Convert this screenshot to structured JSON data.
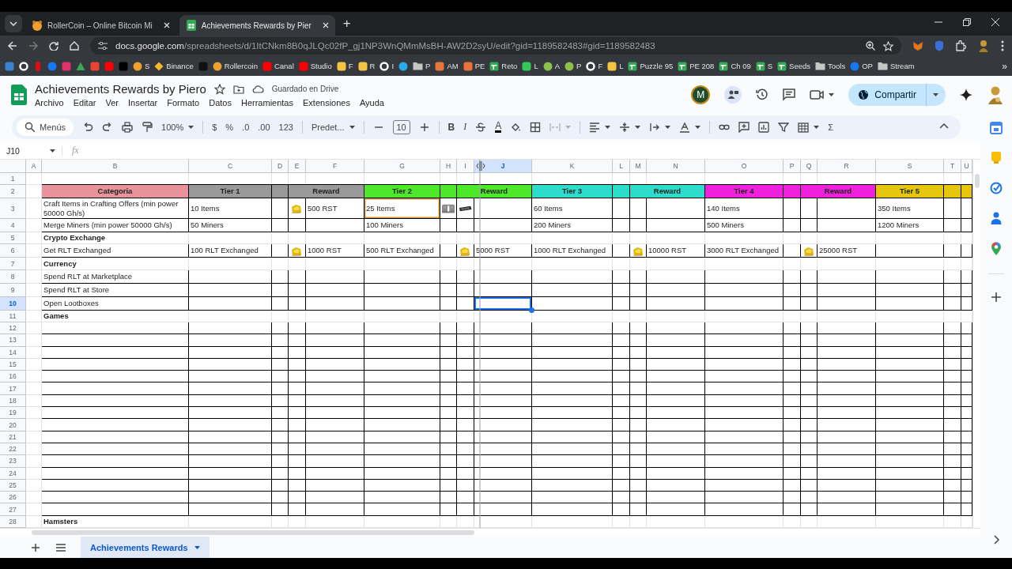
{
  "browser": {
    "tabs": [
      {
        "kind": "site",
        "title": "RollerCoin – Online Bitcoin Mi",
        "selected": false
      },
      {
        "kind": "sheets",
        "title": "Achievements Rewards by Pier",
        "selected": true
      }
    ],
    "new_tab": "+",
    "url": {
      "host": "docs.google.com",
      "path": "/spreadsheets/d/1ItCNkm8B0qJLQc02fP_gj1NP3WnQMmMsBH-AW2D2syU/edit?gid=1189582483#gid=1189582483"
    },
    "bookmarks": [
      {
        "kind": "square",
        "color": "#3b82d6"
      },
      {
        "kind": "ring",
        "color": "#ffffff"
      },
      {
        "kind": "bar",
        "color": "#e50914"
      },
      {
        "kind": "circle",
        "color": "#1877f2"
      },
      {
        "kind": "square",
        "color": "#e1306c"
      },
      {
        "kind": "triangle",
        "color": "#34a853"
      },
      {
        "kind": "square",
        "color": "#ea4335"
      },
      {
        "kind": "square",
        "color": "#ff0000"
      },
      {
        "kind": "square",
        "color": "#000000"
      },
      {
        "kind": "circle",
        "color": "#f0a030",
        "label": "S"
      },
      {
        "kind": "diamond",
        "color": "#f3ba2f",
        "label": "Binance"
      },
      {
        "kind": "square",
        "color": "#111111"
      },
      {
        "kind": "circle",
        "color": "#f0a030",
        "label": "Rollercoin"
      },
      {
        "kind": "square",
        "color": "#ff0000",
        "label": "Canal"
      },
      {
        "kind": "square",
        "color": "#ff0000",
        "label": "Studio"
      },
      {
        "kind": "square",
        "color": "#f5c542",
        "label": "F"
      },
      {
        "kind": "square",
        "color": "#f5c542",
        "label": "R"
      },
      {
        "kind": "ring",
        "color": "#ffffff",
        "label": "I"
      },
      {
        "kind": "circle",
        "color": "#2aabee"
      },
      {
        "kind": "folder",
        "color": "#c4c7c5",
        "label": "P"
      },
      {
        "kind": "square",
        "color": "#e8743b",
        "label": "AM"
      },
      {
        "kind": "square",
        "color": "#e8743b",
        "label": "PE"
      },
      {
        "kind": "sheet",
        "color": "#34a853",
        "label": "Reto"
      },
      {
        "kind": "square",
        "color": "#34c759",
        "label": "L"
      },
      {
        "kind": "circle",
        "color": "#8bc34a",
        "label": "A"
      },
      {
        "kind": "circle",
        "color": "#8bc34a",
        "label": "P"
      },
      {
        "kind": "ring",
        "color": "#ffffff",
        "label": "F"
      },
      {
        "kind": "square",
        "color": "#f5c542",
        "label": "L"
      },
      {
        "kind": "sheet",
        "color": "#34a853",
        "label": "Puzzle 95"
      },
      {
        "kind": "sheet",
        "color": "#34a853",
        "label": "PE 208"
      },
      {
        "kind": "sheet",
        "color": "#34a853",
        "label": "Ch 09"
      },
      {
        "kind": "sheet",
        "color": "#34a853",
        "label": "S"
      },
      {
        "kind": "sheet",
        "color": "#34a853",
        "label": "Seeds"
      },
      {
        "kind": "folder",
        "color": "#c4c7c5",
        "label": "Tools"
      },
      {
        "kind": "circle",
        "color": "#1877f2",
        "label": "OP"
      },
      {
        "kind": "folder",
        "color": "#c4c7c5",
        "label": "Stream"
      }
    ],
    "more_bookmarks": "»"
  },
  "doc": {
    "title": "Achievements Rewards by Piero",
    "save_status": "Guardado en Drive",
    "menu": [
      "Archivo",
      "Editar",
      "Ver",
      "Insertar",
      "Formato",
      "Datos",
      "Herramientas",
      "Extensiones",
      "Ayuda"
    ],
    "avatar": "M",
    "share": "Compartir"
  },
  "toolbar": {
    "search_placeholder": "Menús",
    "zoom": "100%",
    "currency": "$",
    "percent": "%",
    "decrease_decimals": ".0",
    "increase_decimals": ".00",
    "number_format": "123",
    "font": "Predet...",
    "font_size": "10",
    "bold": "B",
    "italic": "I",
    "text_color": "A",
    "sum": "Σ"
  },
  "formula_bar": {
    "cell": "J10",
    "fx": "fx"
  },
  "sheet": {
    "columns": [
      {
        "label": "A",
        "selected": false
      },
      {
        "label": "B",
        "selected": false
      },
      {
        "label": "C",
        "selected": false
      },
      {
        "label": "D",
        "selected": false
      },
      {
        "label": "E",
        "selected": false
      },
      {
        "label": "F",
        "selected": false
      },
      {
        "label": "G",
        "selected": false
      },
      {
        "label": "H",
        "selected": false
      },
      {
        "label": "I",
        "selected": false
      },
      {
        "label": "J",
        "selected": true
      },
      {
        "label": "K",
        "selected": false
      },
      {
        "label": "L",
        "selected": false
      },
      {
        "label": "M",
        "selected": false
      },
      {
        "label": "N",
        "selected": false
      },
      {
        "label": "O",
        "selected": false
      },
      {
        "label": "P",
        "selected": false
      },
      {
        "label": "Q",
        "selected": false
      },
      {
        "label": "R",
        "selected": false
      },
      {
        "label": "S",
        "selected": false
      },
      {
        "label": "T",
        "selected": false
      },
      {
        "label": "U",
        "selected": false
      }
    ],
    "rows": [
      {
        "label": "1",
        "selected": false,
        "kind": "blank"
      },
      {
        "label": "2",
        "selected": false,
        "kind": "header",
        "cells": [
          {
            "kind": "empty"
          },
          {
            "kind": "text",
            "text": "Categoria",
            "color": "#e8939c"
          },
          {
            "kind": "text",
            "text": "Tier 1",
            "color": "#999999"
          },
          {
            "kind": "fill",
            "color": "#999999"
          },
          {
            "kind": "text",
            "text": "Reward",
            "color": "#999999"
          },
          {
            "kind": "merged"
          },
          {
            "kind": "text",
            "text": "Tier 2",
            "color": "#4de82a"
          },
          {
            "kind": "fill",
            "color": "#4de82a"
          },
          {
            "kind": "text",
            "text": "Reward",
            "color": "#4de82a"
          },
          {
            "kind": "merged"
          },
          {
            "kind": "text",
            "text": "Tier 3",
            "color": "#2ddccb"
          },
          {
            "kind": "fill",
            "color": "#2ddccb"
          },
          {
            "kind": "text",
            "text": "Reward",
            "color": "#2ddccb"
          },
          {
            "kind": "merged"
          },
          {
            "kind": "text",
            "text": "Tier 4",
            "color": "#ee22dc"
          },
          {
            "kind": "fill",
            "color": "#ee22dc"
          },
          {
            "kind": "text",
            "text": "Reward",
            "color": "#ee22dc"
          },
          {
            "kind": "merged"
          },
          {
            "kind": "text",
            "text": "Tier 5",
            "color": "#e5c60c"
          },
          {
            "kind": "fill",
            "color": "#e5c60c"
          },
          {
            "kind": "fill",
            "color": "#e5c60c"
          }
        ]
      },
      {
        "label": "3",
        "selected": false,
        "kind": "data",
        "cells": [
          {
            "kind": "empty"
          },
          {
            "kind": "text",
            "text": "Craft Items in Crafting Offers (min power 50000 Gh/s)"
          },
          {
            "kind": "text",
            "text": "10 Items"
          },
          {
            "kind": "empty"
          },
          {
            "kind": "coin"
          },
          {
            "kind": "text",
            "text": "500 RST"
          },
          {
            "kind": "outlined",
            "text": "25 Items"
          },
          {
            "kind": "picture"
          },
          {
            "kind": "picture"
          },
          {
            "kind": "empty"
          },
          {
            "kind": "text",
            "text": "60 Items"
          },
          {
            "kind": "empty"
          },
          {
            "kind": "empty"
          },
          {
            "kind": "empty"
          },
          {
            "kind": "text",
            "text": "140 Items"
          },
          {
            "kind": "empty"
          },
          {
            "kind": "empty"
          },
          {
            "kind": "empty"
          },
          {
            "kind": "text",
            "text": "350 Items"
          }
        ]
      },
      {
        "label": "4",
        "selected": false,
        "kind": "data",
        "cells": [
          {
            "kind": "empty"
          },
          {
            "kind": "text",
            "text": "Merge Miners (min power 50000 Gh/s)"
          },
          {
            "kind": "text",
            "text": "50 Miners"
          },
          {
            "kind": "empty"
          },
          {
            "kind": "empty"
          },
          {
            "kind": "empty"
          },
          {
            "kind": "text",
            "text": "100 Miners"
          },
          {
            "kind": "empty"
          },
          {
            "kind": "empty"
          },
          {
            "kind": "empty"
          },
          {
            "kind": "text",
            "text": "200 Miners"
          },
          {
            "kind": "empty"
          },
          {
            "kind": "empty"
          },
          {
            "kind": "empty"
          },
          {
            "kind": "text",
            "text": "500 Miners"
          },
          {
            "kind": "empty"
          },
          {
            "kind": "empty"
          },
          {
            "kind": "empty"
          },
          {
            "kind": "text",
            "text": "1200 Miners"
          }
        ]
      },
      {
        "label": "5",
        "selected": false,
        "kind": "section",
        "cells": [
          {
            "kind": "empty"
          },
          {
            "kind": "text",
            "text": "Crypto Exchange"
          }
        ]
      },
      {
        "label": "6",
        "selected": false,
        "kind": "data",
        "cells": [
          {
            "kind": "empty"
          },
          {
            "kind": "text",
            "text": "Get RLT Exchanged"
          },
          {
            "kind": "text",
            "text": "100 RLT Exchanged"
          },
          {
            "kind": "empty"
          },
          {
            "kind": "coin"
          },
          {
            "kind": "text",
            "text": "1000 RST"
          },
          {
            "kind": "text",
            "text": "500 RLT Exchanged"
          },
          {
            "kind": "empty"
          },
          {
            "kind": "coin"
          },
          {
            "kind": "text",
            "text": "5000 RST"
          },
          {
            "kind": "text",
            "text": "1000 RLT Exchanged"
          },
          {
            "kind": "empty"
          },
          {
            "kind": "coin"
          },
          {
            "kind": "text",
            "text": "10000 RST"
          },
          {
            "kind": "text",
            "text": "3000 RLT Exchanged"
          },
          {
            "kind": "empty"
          },
          {
            "kind": "coin"
          },
          {
            "kind": "text",
            "text": "25000 RST"
          }
        ]
      },
      {
        "label": "7",
        "selected": false,
        "kind": "section",
        "cells": [
          {
            "kind": "empty"
          },
          {
            "kind": "text",
            "text": "Currency"
          }
        ]
      },
      {
        "label": "8",
        "selected": false,
        "kind": "data",
        "cells": [
          {
            "kind": "empty"
          },
          {
            "kind": "text",
            "text": "Spend RLT at Marketplace"
          }
        ]
      },
      {
        "label": "9",
        "selected": false,
        "kind": "data",
        "cells": [
          {
            "kind": "empty"
          },
          {
            "kind": "text",
            "text": "Spend RLT at Store"
          }
        ]
      },
      {
        "label": "10",
        "selected": true,
        "kind": "data",
        "cells": [
          {
            "kind": "empty"
          },
          {
            "kind": "text",
            "text": "Open Lootboxes"
          }
        ]
      },
      {
        "label": "11",
        "selected": false,
        "kind": "section",
        "cells": [
          {
            "kind": "empty"
          },
          {
            "kind": "text",
            "text": "Games"
          }
        ]
      },
      {
        "label": "12",
        "selected": false,
        "kind": "data"
      },
      {
        "label": "13",
        "selected": false,
        "kind": "data"
      },
      {
        "label": "14",
        "selected": false,
        "kind": "data"
      },
      {
        "label": "15",
        "selected": false,
        "kind": "data"
      },
      {
        "label": "16",
        "selected": false,
        "kind": "data"
      },
      {
        "label": "17",
        "selected": false,
        "kind": "data"
      },
      {
        "label": "18",
        "selected": false,
        "kind": "data"
      },
      {
        "label": "19",
        "selected": false,
        "kind": "data"
      },
      {
        "label": "20",
        "selected": false,
        "kind": "data"
      },
      {
        "label": "21",
        "selected": false,
        "kind": "data"
      },
      {
        "label": "22",
        "selected": false,
        "kind": "data"
      },
      {
        "label": "23",
        "selected": false,
        "kind": "data"
      },
      {
        "label": "24",
        "selected": false,
        "kind": "data"
      },
      {
        "label": "25",
        "selected": false,
        "kind": "data"
      },
      {
        "label": "26",
        "selected": false,
        "kind": "data"
      },
      {
        "label": "27",
        "selected": false,
        "kind": "data"
      },
      {
        "label": "28",
        "selected": false,
        "kind": "section",
        "cells": [
          {
            "kind": "empty"
          },
          {
            "kind": "text",
            "text": "Hamsters"
          }
        ]
      }
    ]
  },
  "sheet_tabs": [
    {
      "label": "Achievements Rewards",
      "selected": true
    }
  ]
}
